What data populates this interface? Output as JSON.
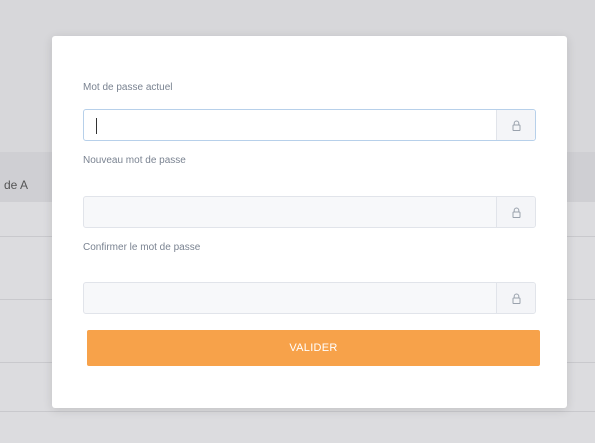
{
  "background": {
    "table_header_fragment": "de A"
  },
  "form": {
    "current_password": {
      "label": "Mot de passe actuel",
      "value": "",
      "placeholder": ""
    },
    "new_password": {
      "label": "Nouveau mot de passe",
      "value": "",
      "placeholder": ""
    },
    "confirm_password": {
      "label": "Confirmer le mot de passe",
      "value": "",
      "placeholder": ""
    },
    "submit_label": "VALIDER"
  },
  "icons": {
    "field_addon": "lock-icon"
  },
  "colors": {
    "accent": "#f7a24a",
    "focus_border": "#b7d0ea",
    "label": "#7a8391"
  }
}
